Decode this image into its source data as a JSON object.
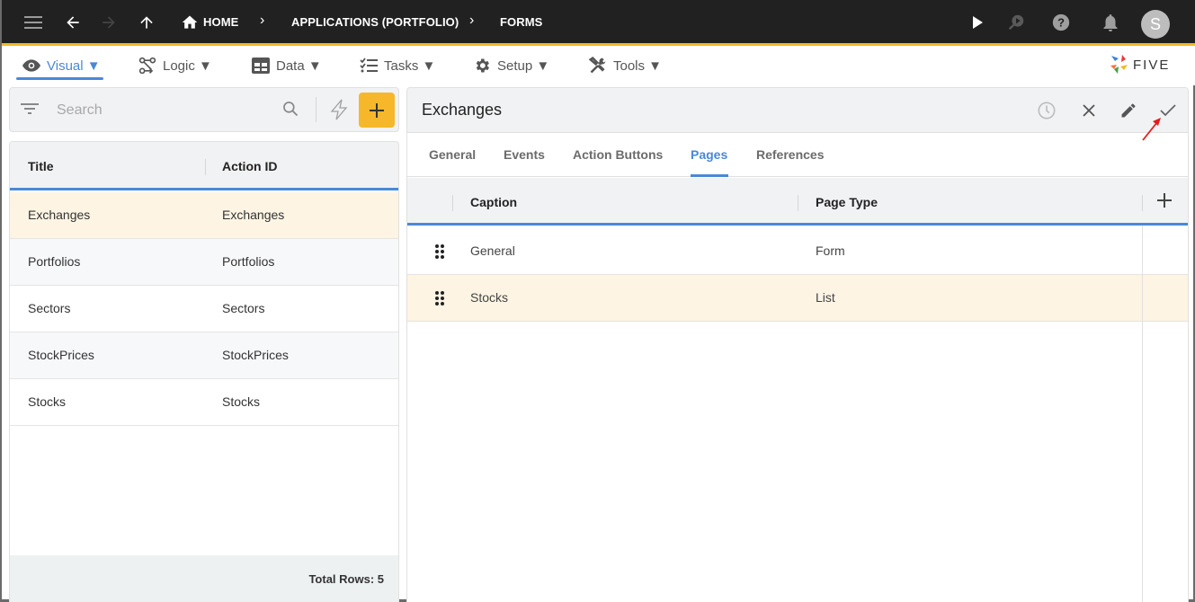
{
  "topbar": {
    "icons": [
      "menu-icon",
      "back-arrow-icon",
      "forward-arrow-icon",
      "up-arrow-icon"
    ],
    "breadcrumbs": [
      {
        "label": "HOME",
        "icon": "home-icon"
      },
      {
        "label": "APPLICATIONS (PORTFOLIO)"
      },
      {
        "label": "FORMS"
      }
    ],
    "right_icons": [
      "play-icon",
      "search-play-icon",
      "help-icon",
      "bell-icon"
    ],
    "avatar_initial": "S",
    "accent_color": "#f5b826"
  },
  "menubar": {
    "items": [
      {
        "label": "Visual ▼",
        "icon": "eye-icon",
        "active": true
      },
      {
        "label": "Logic ▼",
        "icon": "logic-icon"
      },
      {
        "label": "Data ▼",
        "icon": "table-icon"
      },
      {
        "label": "Tasks ▼",
        "icon": "checklist-icon"
      },
      {
        "label": "Setup ▼",
        "icon": "gear-icon"
      },
      {
        "label": "Tools ▼",
        "icon": "tools-icon"
      }
    ],
    "brand": "FIVE",
    "active_color": "#4a88d6"
  },
  "left": {
    "search_placeholder": "Search",
    "columns": [
      "Title",
      "Action ID"
    ],
    "rows": [
      {
        "title": "Exchanges",
        "action_id": "Exchanges",
        "selected": true
      },
      {
        "title": "Portfolios",
        "action_id": "Portfolios"
      },
      {
        "title": "Sectors",
        "action_id": "Sectors"
      },
      {
        "title": "StockPrices",
        "action_id": "StockPrices"
      },
      {
        "title": "Stocks",
        "action_id": "Stocks"
      }
    ],
    "footer": "Total Rows: 5"
  },
  "detail": {
    "title": "Exchanges",
    "header_icons": [
      "history-icon",
      "close-icon",
      "edit-icon",
      "check-icon"
    ],
    "tabs": [
      "General",
      "Events",
      "Action Buttons",
      "Pages",
      "References"
    ],
    "active_tab": "Pages",
    "columns": [
      "Caption",
      "Page Type"
    ],
    "rows": [
      {
        "caption": "General",
        "page_type": "Form"
      },
      {
        "caption": "Stocks",
        "page_type": "List",
        "selected": true
      }
    ]
  }
}
